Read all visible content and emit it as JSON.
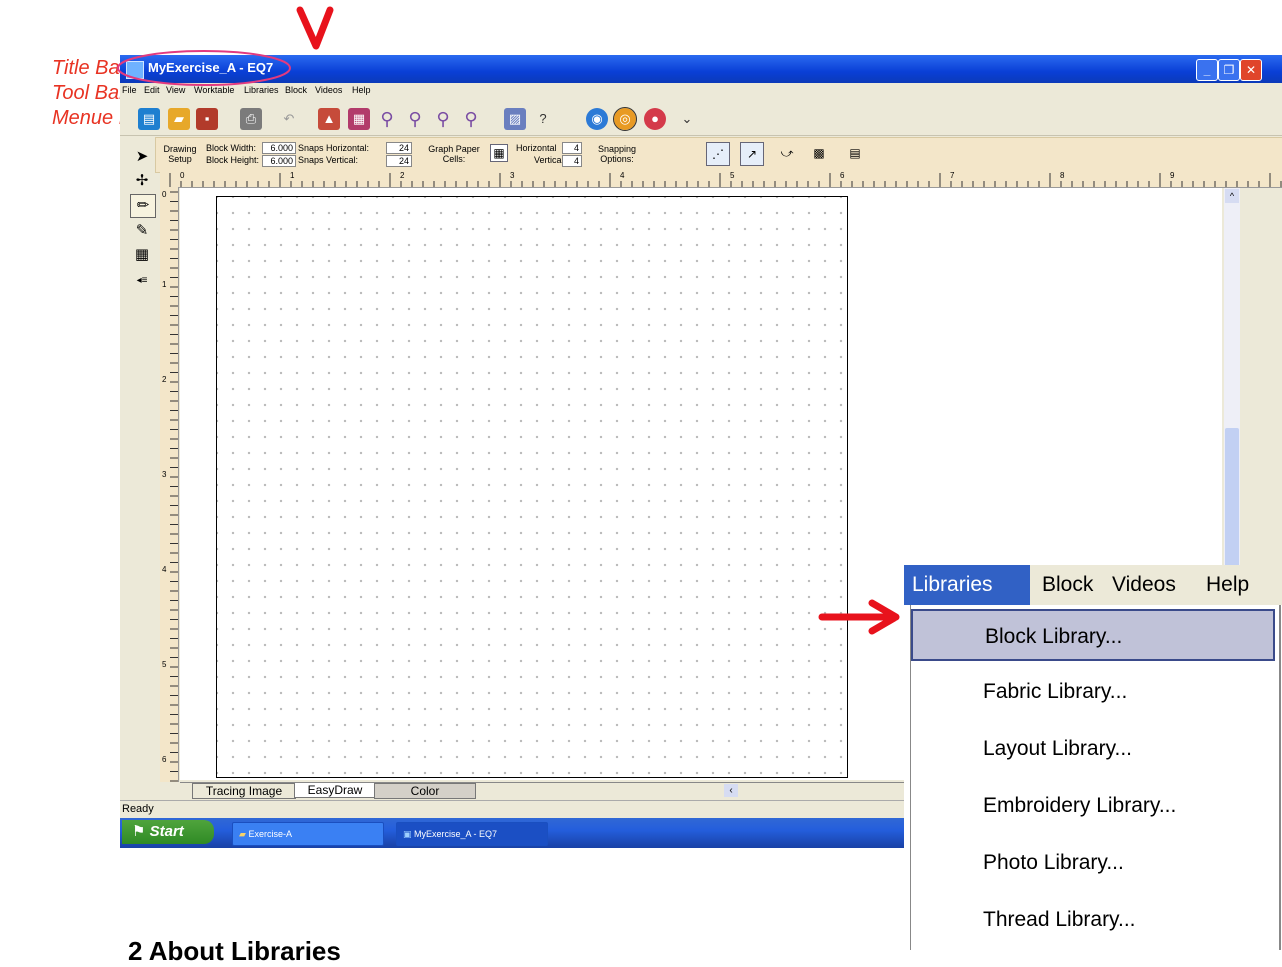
{
  "annotations": {
    "title_bar": "Title Bar",
    "tool_bar": "Tool Bar",
    "menu_bar": "Menue Bar"
  },
  "window": {
    "title": "MyExercise_A - EQ7",
    "menu": [
      "File",
      "Edit",
      "View",
      "Worktable",
      "Libraries",
      "Block",
      "Videos",
      "Help"
    ]
  },
  "propbar": {
    "drawing_setup": "Drawing Setup",
    "block_width_label": "Block Width:",
    "block_width": "6.000",
    "block_height_label": "Block Height:",
    "block_height": "6.000",
    "snaps_h_label": "Snaps Horizontal:",
    "snaps_h": "24",
    "snaps_v_label": "Snaps Vertical:",
    "snaps_v": "24",
    "graph_paper_label": "Graph Paper Cells:",
    "horizontal_label": "Horizontal",
    "horizontal": "4",
    "vertical_label": "Vertical",
    "vertical": "4",
    "snapping_label": "Snapping Options:"
  },
  "rulers": {
    "top": [
      "0",
      "1",
      "2",
      "3",
      "4",
      "5",
      "6",
      "7",
      "8",
      "9"
    ],
    "left": [
      "0",
      "1",
      "2",
      "3",
      "4",
      "5",
      "6"
    ]
  },
  "tabs": [
    "Tracing Image",
    "EasyDraw",
    "Color"
  ],
  "status": "Ready",
  "taskbar": {
    "start": "Start",
    "items": [
      "Exercise-A",
      "MyExercise_A - EQ7"
    ]
  },
  "dropdown": {
    "menubar": [
      "Libraries",
      "Block",
      "Videos",
      "Help"
    ],
    "items": [
      "Block Library...",
      "Fabric Library...",
      "Layout Library...",
      "Embroidery Library...",
      "Photo Library...",
      "Thread Library..."
    ]
  },
  "heading": "2 About Libraries",
  "colors": {
    "annotation": "#e83323",
    "titlebar": "#0a3fd6",
    "highlight": "#c0c2d8"
  }
}
